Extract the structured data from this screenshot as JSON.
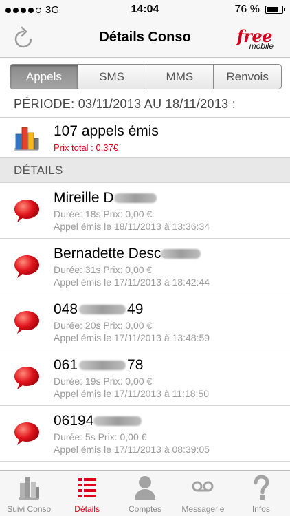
{
  "status_bar": {
    "carrier": "3G",
    "time": "14:04",
    "battery": "76 %",
    "battery_level": 0.76,
    "signal_bars": 4
  },
  "nav": {
    "title": "Détails Conso",
    "brand_name": "free",
    "brand_sub": "mobile",
    "brand_color": "#d4001f"
  },
  "segments": [
    {
      "label": "Appels",
      "active": true
    },
    {
      "label": "SMS",
      "active": false
    },
    {
      "label": "MMS",
      "active": false
    },
    {
      "label": "Renvois",
      "active": false
    }
  ],
  "period": "PÉRIODE: 03/11/2013 AU 18/11/2013 :",
  "summary": {
    "title": "107 appels émis",
    "price": "Prix total : 0.37€"
  },
  "section_title": "DÉTAILS",
  "calls": [
    {
      "name_prefix": "Mireille D",
      "name_suffix": "",
      "line1": "Durée: 18s Prix: 0,00 €",
      "line2": "Appel émis le 18/11/2013 à 13:36:34"
    },
    {
      "name_prefix": "Bernadette Desc",
      "name_suffix": "",
      "line1": "Durée: 31s Prix: 0,00 €",
      "line2": "Appel émis le 17/11/2013 à 18:42:44"
    },
    {
      "name_prefix": "048",
      "name_suffix": "49",
      "line1": "Durée: 20s Prix: 0,00 €",
      "line2": "Appel émis le 17/11/2013 à 13:48:59"
    },
    {
      "name_prefix": "061",
      "name_suffix": "78",
      "line1": "Durée: 19s Prix: 0,00 €",
      "line2": "Appel émis le 17/11/2013 à 11:18:50"
    },
    {
      "name_prefix": "06194",
      "name_suffix": "",
      "line1": "Durée: 5s Prix: 0,00 €",
      "line2": "Appel émis le 17/11/2013 à 08:39:05"
    }
  ],
  "tabs": [
    {
      "label": "Suivi Conso",
      "icon": "bar-chart-icon",
      "active": false
    },
    {
      "label": "Détails",
      "icon": "list-icon",
      "active": true
    },
    {
      "label": "Comptes",
      "icon": "user-icon",
      "active": false
    },
    {
      "label": "Messagerie",
      "icon": "voicemail-icon",
      "active": false
    },
    {
      "label": "Infos",
      "icon": "question-icon",
      "active": false
    }
  ],
  "colors": {
    "accent": "#e0001b",
    "segment_active": "#999999"
  }
}
